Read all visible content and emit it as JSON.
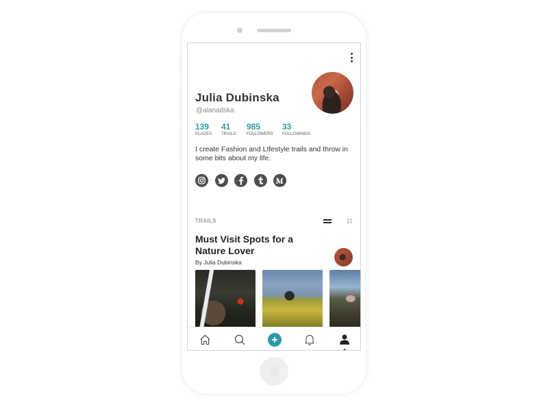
{
  "profile": {
    "name": "Julia Dubinska",
    "handle": "@alanadska",
    "bio": "I create Fashion and LIfestyle trails and throw in some bits about my life.",
    "stats": [
      {
        "value": "139",
        "label": "PLACES"
      },
      {
        "value": "41",
        "label": "TRAILS"
      },
      {
        "value": "985",
        "label": "FOLLOWERS"
      },
      {
        "value": "33",
        "label": "FOLLOWINGS"
      }
    ],
    "socials": [
      {
        "icon": "instagram-icon",
        "glyph": "◎"
      },
      {
        "icon": "twitter-icon",
        "glyph": "t"
      },
      {
        "icon": "facebook-icon",
        "glyph": "f"
      },
      {
        "icon": "tumblr-icon",
        "glyph": "t"
      },
      {
        "icon": "medium-icon",
        "glyph": "M"
      }
    ]
  },
  "trails_section": {
    "label": "TRAILS",
    "trail": {
      "title": "Must Visit Spots for a Nature Lover",
      "author": "By Julia Dubinska",
      "photos": [
        "waterfall",
        "field-hiker",
        "cliff-person"
      ]
    }
  },
  "tabbar": {
    "tabs": [
      "home",
      "search",
      "add",
      "notifications",
      "profile"
    ],
    "active": "profile"
  },
  "colors": {
    "accent": "#2a9aa6",
    "icon_dark": "#4e4e52",
    "text": "#333333"
  }
}
